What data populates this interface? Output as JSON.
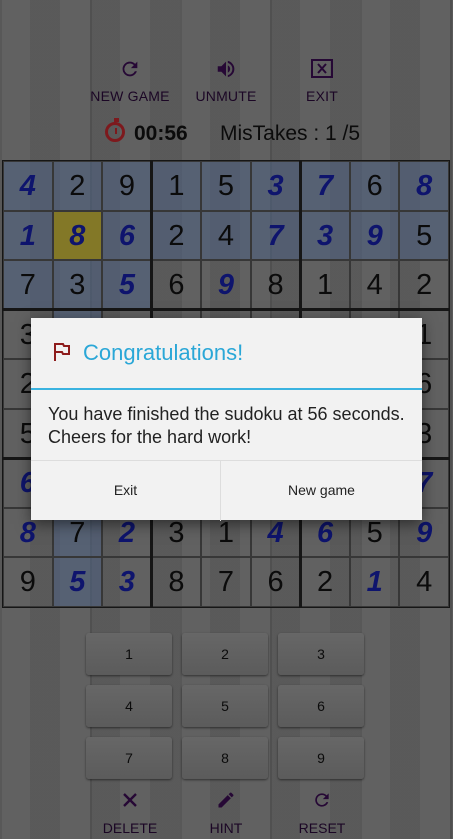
{
  "toolbar": {
    "new_game": "NEW GAME",
    "unmute": "UNMUTE",
    "exit": "EXIT",
    "icons": [
      "refresh-icon",
      "volume-icon",
      "close-box-icon"
    ]
  },
  "status": {
    "timer": "00:56",
    "mistakes": "MisTakes : 1 /5"
  },
  "board": {
    "rows": [
      [
        "4",
        "2",
        "9",
        "1",
        "5",
        "3",
        "7",
        "6",
        "8"
      ],
      [
        "1",
        "8",
        "6",
        "2",
        "4",
        "7",
        "3",
        "9",
        "5"
      ],
      [
        "7",
        "3",
        "5",
        "6",
        "9",
        "8",
        "1",
        "4",
        "2"
      ],
      [
        "3",
        "",
        "",
        "",
        "",
        "",
        "",
        "",
        "1"
      ],
      [
        "2",
        "",
        "",
        "",
        "",
        "",
        "",
        "",
        "6"
      ],
      [
        "5",
        "",
        "",
        "",
        "",
        "",
        "",
        "",
        "3"
      ],
      [
        "6",
        "",
        "",
        "",
        "",
        "",
        "",
        "",
        "7"
      ],
      [
        "8",
        "7",
        "2",
        "3",
        "1",
        "4",
        "6",
        "5",
        "9"
      ],
      [
        "9",
        "5",
        "3",
        "8",
        "7",
        "6",
        "2",
        "1",
        "4"
      ]
    ],
    "user_cells": [
      [
        0,
        0
      ],
      [
        0,
        5
      ],
      [
        0,
        6
      ],
      [
        0,
        8
      ],
      [
        1,
        0
      ],
      [
        1,
        1
      ],
      [
        1,
        2
      ],
      [
        1,
        5
      ],
      [
        1,
        6
      ],
      [
        1,
        7
      ],
      [
        2,
        2
      ],
      [
        2,
        4
      ],
      [
        6,
        0
      ],
      [
        6,
        8
      ],
      [
        7,
        0
      ],
      [
        7,
        2
      ],
      [
        7,
        5
      ],
      [
        7,
        6
      ],
      [
        7,
        8
      ],
      [
        8,
        1
      ],
      [
        8,
        2
      ],
      [
        8,
        7
      ]
    ],
    "highlight_cells": [
      [
        0,
        0
      ],
      [
        0,
        1
      ],
      [
        0,
        2
      ],
      [
        0,
        3
      ],
      [
        0,
        4
      ],
      [
        0,
        5
      ],
      [
        0,
        6
      ],
      [
        0,
        7
      ],
      [
        0,
        8
      ],
      [
        1,
        0
      ],
      [
        1,
        2
      ],
      [
        1,
        3
      ],
      [
        1,
        4
      ],
      [
        1,
        5
      ],
      [
        1,
        6
      ],
      [
        1,
        7
      ],
      [
        1,
        8
      ],
      [
        2,
        0
      ],
      [
        2,
        1
      ],
      [
        2,
        2
      ],
      [
        3,
        1
      ],
      [
        4,
        1
      ],
      [
        5,
        1
      ],
      [
        6,
        1
      ],
      [
        7,
        1
      ],
      [
        8,
        1
      ]
    ],
    "selected_cell": [
      1,
      1
    ]
  },
  "keypad": [
    "1",
    "2",
    "3",
    "4",
    "5",
    "6",
    "7",
    "8",
    "9"
  ],
  "bottom": {
    "delete": "DELETE",
    "hint": "HINT",
    "reset": "RESET"
  },
  "dialog": {
    "title": "Congratulations!",
    "message": "You have finished the sudoku at 56 seconds. Cheers for the hard work!",
    "exit_button": "Exit",
    "new_game_button": "New game"
  },
  "colors": {
    "accent": "#2aa7d7",
    "user_digit": "#1620a8",
    "timer_icon": "#c0272d",
    "selected_cell": "#c9b93c"
  }
}
